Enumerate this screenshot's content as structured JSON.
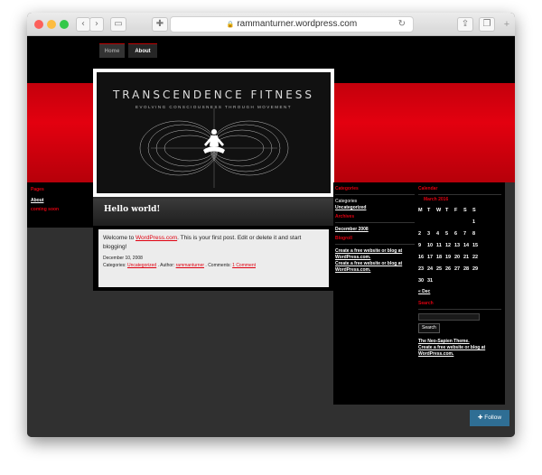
{
  "browser": {
    "url": "rammanturner.wordpress.com",
    "lock_icon": "lock-icon"
  },
  "nav": {
    "tabs": [
      "Home",
      "About"
    ]
  },
  "header": {
    "title": "TRANSCENDENCE FITNESS",
    "tagline": "EVOLVING CONSCIOUSNESS THROUGH MOVEMENT"
  },
  "left_sidebar": {
    "heading": "Pages",
    "items": [
      "About",
      "coming soon"
    ]
  },
  "post": {
    "title": "Hello world!",
    "body_pre": "Welcome to ",
    "body_link": "WordPress.com",
    "body_post": ". This is your first post. Edit or delete it and start blogging!",
    "date": "December 10, 2008",
    "categories_label": "Categories: ",
    "category": "Uncategorized",
    "author_label": " . Author: ",
    "author": "rammanturner",
    "comments_label": " . Comments: ",
    "comments": "1 Comment"
  },
  "sidebar_mid": {
    "categories_heading": "Categories",
    "categories_text": "Categories",
    "category_link": "Uncategorized",
    "archives_heading": "Archives",
    "archive_link": "December 2008",
    "blogroll_heading": "Blogroll",
    "blogroll_links": [
      "Create a free website or blog at WordPress.com.",
      "Create a free website or blog at WordPress.com."
    ]
  },
  "calendar": {
    "heading": "Calendar",
    "month": "March 2016",
    "days": [
      "M",
      "T",
      "W",
      "T",
      "F",
      "S",
      "S"
    ],
    "rows": [
      [
        "",
        "",
        "",
        "",
        "",
        "",
        "1"
      ],
      [
        "2",
        "3",
        "4",
        "5",
        "6",
        "7",
        "8"
      ],
      [
        "9",
        "10",
        "11",
        "12",
        "13",
        "14",
        "15"
      ],
      [
        "16",
        "17",
        "18",
        "19",
        "20",
        "21",
        "22"
      ],
      [
        "23",
        "24",
        "25",
        "26",
        "27",
        "28",
        "29"
      ],
      [
        "30",
        "31",
        "",
        "",
        "",
        "",
        ""
      ]
    ],
    "prev": "« Dec"
  },
  "search": {
    "heading": "Search",
    "button": "Search"
  },
  "footer_links": {
    "theme": "The Neo-Sapien Theme.",
    "create": "Create a free website or blog at WordPress.com."
  },
  "follow": {
    "label": "Follow"
  },
  "colors": {
    "accent": "#e00010",
    "follow": "#2f6e94"
  }
}
